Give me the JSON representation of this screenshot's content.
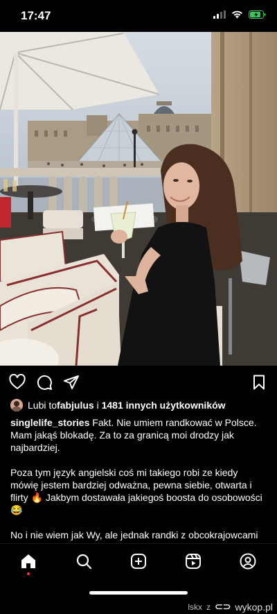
{
  "status_bar": {
    "time": "17:47"
  },
  "post": {
    "likes_prefix": "Lubi to ",
    "liker_username": "fabjulus",
    "likes_connector": " i ",
    "likes_others": "1481 innych użytkowników",
    "author": "singlelife_stories",
    "caption_lines": [
      "Fakt. Nie umiem randkować w Polsce. Mam jakąś blokadę. Za to za granicą moi drodzy jak najbardziej.",
      "Poza tym język angielski coś mi takiego robi ze kiedy mówię jestem bardziej odważna, pewna siebie, otwarta i flirty 🔥 Jakbym dostawała jakiegoś boosta do osobowości 😂",
      "No i nie wiem jak Wy, ale jednak randki z obcokrajowcami to jest inny klimat. Ja zdecydowanie wole."
    ]
  },
  "tabbar": {
    "items": [
      "home-icon",
      "search-icon",
      "create-icon",
      "reels-icon",
      "profile-icon"
    ]
  },
  "watermark": {
    "user": "lskx",
    "separator": "z",
    "site": "wykop.pl"
  },
  "colors": {
    "background": "#000000",
    "battery": "#34c759",
    "notification_dot": "#ff3040"
  }
}
